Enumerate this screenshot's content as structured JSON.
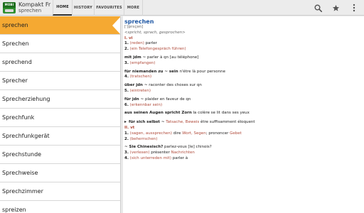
{
  "app": {
    "title": "Kompakt Fr",
    "subtitle": "sprechen",
    "logo_text": "MOBI"
  },
  "tabs": [
    {
      "label": "HOME",
      "active": true
    },
    {
      "label": "HISTORY",
      "active": false
    },
    {
      "label": "FAVOURITES",
      "active": false
    },
    {
      "label": "MORE",
      "active": false
    }
  ],
  "actions": {
    "search_icon": "search-icon",
    "favourite_icon": "star-icon",
    "menu_icon": "overflow-menu-icon"
  },
  "word_list": {
    "selected_index": 0,
    "items": [
      "sprechen",
      "Sprechen",
      "sprechend",
      "Sprecher",
      "Sprecherziehung",
      "Sprechfunk",
      "Sprechfunkgerät",
      "Sprechstunde",
      "Sprechweise",
      "Sprechzimmer",
      "spreizen"
    ]
  },
  "entry": {
    "headword": "sprechen",
    "pron": "[ˈʃprɛçən]",
    "forms": "<spricht, sprach, gesprochen>",
    "pos1": "I. vi",
    "s1_num": "1.",
    "s1_label": "(reden)",
    "s1_trans": "parler",
    "s2_num": "2.",
    "s2_label": "(ein Telefongespräch führen)",
    "ex_mit_phrase": "mit jdm ~",
    "ex_mit_trans": "parler à qn [au téléphone]",
    "s3_num": "3.",
    "s3_label": "(empfangen)",
    "ex_niemanden_phrase": "für niemanden zu ~ sein",
    "ex_niemanden_trans": "n'être là pour personne",
    "s4_num": "4.",
    "s4_label": "(tratschen)",
    "ex_ueber_phrase": "über jdn ~",
    "ex_ueber_trans": "raconter des choses sur qn",
    "s5_num": "5.",
    "s5_label": "(eintreten)",
    "ex_fuer_phrase": "für jdn ~",
    "ex_fuer_trans": "plaider en faveur de qn",
    "s6_num": "6.",
    "s6_label": "(erkennbar sein)",
    "ex_zorn_phrase": "aus seinen Augen spricht Zorn",
    "ex_zorn_trans": "la colère se lit dans ses yeux",
    "bullet": "▸",
    "ex_selbst_phrase": "für sich selbst ~",
    "ex_selbst_note": "Tatsache, Beweis",
    "ex_selbst_trans": "être suffisamment éloquent",
    "pos2": "II. vt",
    "t1_num": "1.",
    "t1_label": "(sagen, aussprechen)",
    "t1_a": "dire",
    "t1_b": "Wort, Segen",
    "t1_c": "; prononcer",
    "t1_d": "Gebet",
    "t2_num": "2.",
    "t2_label": "(beherrschen)",
    "ex_chin_phrase": "~ Sie Chinesisch?",
    "ex_chin_trans": "parlez-vous [le] chinois?",
    "t3_num": "3.",
    "t3_label": "(verlesen)",
    "t3_trans": "présenter",
    "t3_note": "Nachrichten",
    "t4_num": "4.",
    "t4_label": "(sich unterreden mit)",
    "t4_trans": "parler à"
  },
  "colors": {
    "selection": "#f5a932",
    "headword": "#1e57a4",
    "sense_label": "#b04a3a",
    "logo": "#2f8f2f"
  }
}
